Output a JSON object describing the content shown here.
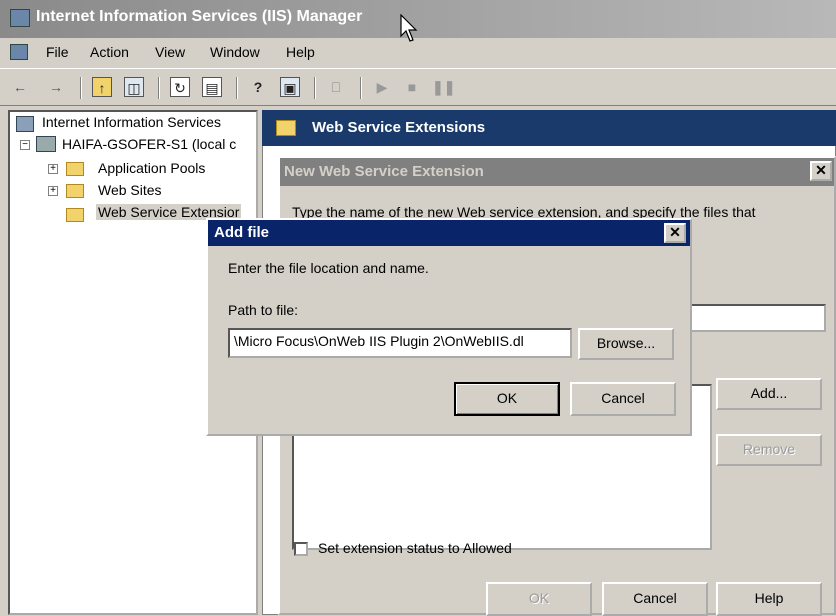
{
  "window": {
    "title": "Internet Information Services (IIS) Manager"
  },
  "menu": {
    "file": "File",
    "action": "Action",
    "view": "View",
    "window": "Window",
    "help": "Help"
  },
  "toolbar": {
    "icons": [
      "back-icon",
      "forward-icon",
      "up-folder-icon",
      "show-tree-icon",
      "refresh-icon",
      "export-icon",
      "help-icon",
      "console-icon",
      "computer-icon",
      "play-icon",
      "stop-icon",
      "pause-icon"
    ]
  },
  "tree": {
    "root": "Internet Information Services",
    "server": "HAIFA-GSOFER-S1 (local c",
    "app_pools": "Application Pools",
    "web_sites": "Web Sites",
    "wse": "Web Service Extensior"
  },
  "right": {
    "header": "Web Service Extensions"
  },
  "new_ext_dialog": {
    "title": "New Web Service Extension",
    "instructions": "Type the name of the new Web service extension, and specify the files that",
    "add_button": "Add...",
    "remove_button": "Remove",
    "checkbox_label": "Set extension status to Allowed",
    "ok": "OK",
    "cancel": "Cancel",
    "help": "Help"
  },
  "add_file_dialog": {
    "title": "Add file",
    "prompt": "Enter the file location and name.",
    "path_label": "Path to file:",
    "path_value": "\\Micro Focus\\OnWeb IIS Plugin 2\\OnWebIIS.dl",
    "browse": "Browse...",
    "ok": "OK",
    "cancel": "Cancel"
  },
  "colors": {
    "active_title": "#0a246a",
    "inactive_title": "#808080",
    "face": "#d4d0c8"
  }
}
